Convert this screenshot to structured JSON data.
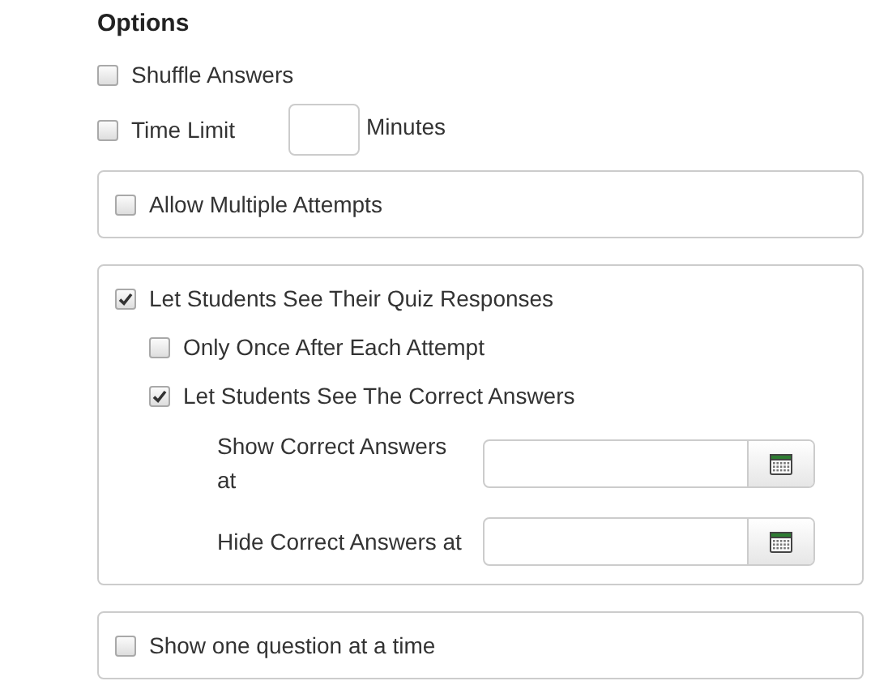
{
  "heading": "Options",
  "top_options": [
    {
      "kind": "checkbox",
      "label": "Shuffle Answers",
      "checked": false
    },
    {
      "kind": "number",
      "label": "Time Limit",
      "checked": false,
      "unit": "Minutes"
    }
  ],
  "panels": [
    {
      "items": [
        {
          "kind": "checkbox",
          "label": "Allow Multiple Attempts",
          "checked": false
        }
      ]
    },
    {
      "items": [
        {
          "kind": "checkbox",
          "label": "Let Students See Their Quiz Responses",
          "checked": true,
          "children": [
            {
              "kind": "checkbox",
              "label": "Only Once After Each Attempt",
              "checked": false
            },
            {
              "kind": "checkbox",
              "label": "Let Students See The Correct Answers",
              "checked": true,
              "children": [
                {
                  "kind": "date",
                  "label": "Show Correct Answers at"
                },
                {
                  "kind": "date",
                  "label": "Hide Correct Answers at"
                }
              ]
            }
          ]
        }
      ]
    },
    {
      "items": [
        {
          "kind": "checkbox",
          "label": "Show one question at a time",
          "checked": false
        }
      ]
    }
  ]
}
